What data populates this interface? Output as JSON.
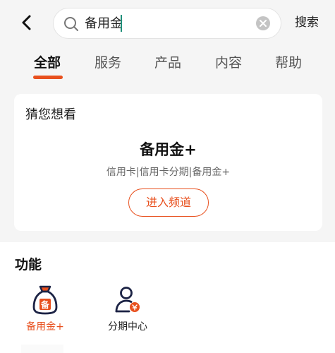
{
  "search": {
    "query": "备用金",
    "button_label": "搜索"
  },
  "tabs": [
    {
      "label": "全部",
      "active": true
    },
    {
      "label": "服务",
      "active": false
    },
    {
      "label": "产品",
      "active": false
    },
    {
      "label": "内容",
      "active": false
    },
    {
      "label": "帮助",
      "active": false
    }
  ],
  "guess": {
    "title": "猜您想看",
    "product_name": "备用金+",
    "tags": "信用卡|信用卡分期|备用金+",
    "button_label": "进入频道"
  },
  "functions": {
    "title": "功能",
    "items": [
      {
        "label": "备用金+",
        "icon": "money-bag-icon",
        "active": true
      },
      {
        "label": "分期中心",
        "icon": "user-installment-icon",
        "active": false
      }
    ]
  },
  "colors": {
    "accent": "#e8501e",
    "navy": "#1c2345",
    "background": "#f5f5f5"
  }
}
